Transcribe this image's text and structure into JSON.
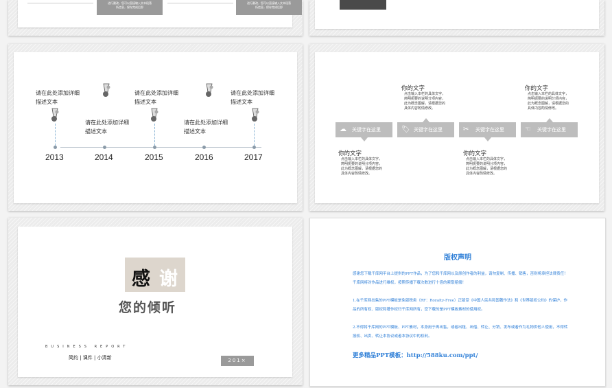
{
  "slide_top_left": {
    "box2_text": "进行删改，您可以直接输入文本段落\n所信息，保存完成后即",
    "box4_text": "进行删改，您可以直接输入文本段落\n所信息，保存完成后即"
  },
  "timeline": {
    "years": [
      "2013",
      "2014",
      "2015",
      "2016",
      "2017"
    ],
    "items": [
      "请在此处添加详细\n描述文本",
      "请在此处添加详细\n描述文本",
      "请在此处添加详细\n描述文本",
      "请在此处添加详细\n描述文本",
      "请在此处添加详细\n描述文本"
    ]
  },
  "keywords": {
    "boxes": [
      {
        "icon": "cloud-icon",
        "label": "关键字在这里"
      },
      {
        "icon": "tag-icon",
        "label": "关键字在这里"
      },
      {
        "icon": "tools-icon",
        "label": "关键字在这里"
      },
      {
        "icon": "hand-icon",
        "label": "关键字在这里"
      }
    ],
    "blocks": [
      {
        "title": "你的文字",
        "body": "点击输入本栏的具体文字，\n简明扼要的说明分项内容，\n此为概念图解，请根据您的\n具体内容酌情修改。"
      },
      {
        "title": "你的文字",
        "body": "点击输入本栏的具体文字，\n简明扼要的说明分项内容，\n此为概念图解，请根据您的\n具体内容酌情修改。"
      },
      {
        "title": "你的文字",
        "body": "点击输入本栏的具体文字，\n简明扼要的说明分项内容，\n此为概念图解，请根据您的\n具体内容酌情修改。"
      },
      {
        "title": "你的文字",
        "body": "点击输入本栏的具体文字，\n简明扼要的说明分项内容，\n此为概念图解，请根据您的\n具体内容酌情修改。"
      }
    ]
  },
  "thanks": {
    "char1": "感",
    "char2": "谢",
    "listen": "您的倾听",
    "business": "BUSINESS REPORT",
    "tags": "简约 | 课件 | 小清新",
    "year": "201×"
  },
  "copyright": {
    "title": "版权声明",
    "p1": "感谢您下载千库网平台上提供的PPT作品，为了您和千库网以及原创作者的利益，请勿复制、传播、销售，否则将承担法律责任！千库网将对作品进行维权，按照传播下载次数进行十倍的索取赔偿！",
    "p2": "1.在千库网出售的PPT模板是免版税类（RF：Royalty-Free）正版受《中国人民共和国著作法》和《世界版权公约》的保护，作品的所有权、版权和著作权归千库网所有，您下载的是PPT模板素材的使用权。",
    "p3": "2.不得将千库网的PPT模板、PPT素材，本身用于再出售，或者出租、出借、转让、分销、发布或者作为礼物供他人使用，不得转授权、出卖、转让本协议或者本协议中的权利。",
    "more": "更多精品PPT模板：http://588ku.com/ppt/"
  },
  "colors": {
    "accent_blue": "#2f7fd7",
    "keyword_gray": "#bdbdbd",
    "thanks_box": "#ddd6cd"
  }
}
